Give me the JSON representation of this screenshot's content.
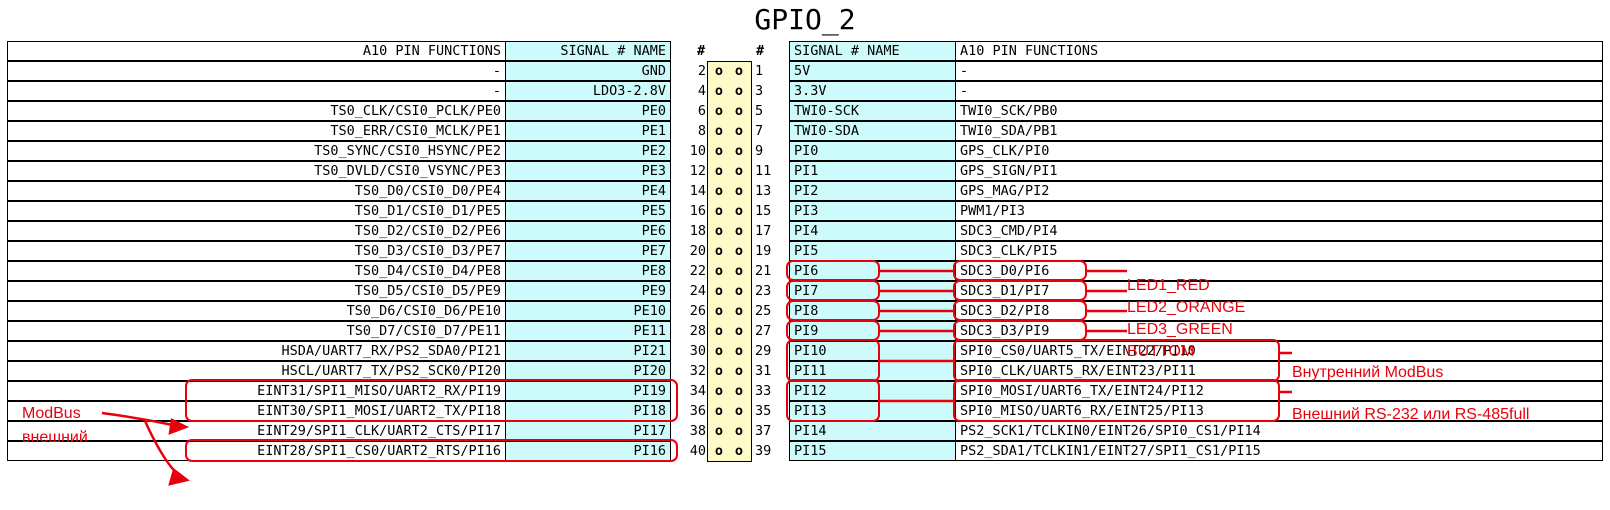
{
  "title": "GPIO_2",
  "header": {
    "left_func": "A10 PIN FUNCTIONS",
    "left_signal": "SIGNAL # NAME",
    "left_hash": "#",
    "right_hash": "#",
    "right_signal": "SIGNAL # NAME",
    "right_func": "A10 PIN FUNCTIONS"
  },
  "pin_marker": "o",
  "rows": [
    {
      "lf": "-",
      "ls": "GND",
      "ln": "2",
      "rn": "1",
      "rs": "5V",
      "rf": "-"
    },
    {
      "lf": "-",
      "ls": "LDO3-2.8V",
      "ln": "4",
      "rn": "3",
      "rs": "3.3V",
      "rf": "-"
    },
    {
      "lf": "TS0_CLK/CSI0_PCLK/PE0",
      "ls": "PE0",
      "ln": "6",
      "rn": "5",
      "rs": "TWI0-SCK",
      "rf": "TWI0_SCK/PB0"
    },
    {
      "lf": "TS0_ERR/CSI0_MCLK/PE1",
      "ls": "PE1",
      "ln": "8",
      "rn": "7",
      "rs": "TWI0-SDA",
      "rf": "TWI0_SDA/PB1"
    },
    {
      "lf": "TS0_SYNC/CSI0_HSYNC/PE2",
      "ls": "PE2",
      "ln": "10",
      "rn": "9",
      "rs": "PI0",
      "rf": "GPS_CLK/PI0"
    },
    {
      "lf": "TS0_DVLD/CSI0_VSYNC/PE3",
      "ls": "PE3",
      "ln": "12",
      "rn": "11",
      "rs": "PI1",
      "rf": "GPS_SIGN/PI1"
    },
    {
      "lf": "TS0_D0/CSI0_D0/PE4",
      "ls": "PE4",
      "ln": "14",
      "rn": "13",
      "rs": "PI2",
      "rf": "GPS_MAG/PI2"
    },
    {
      "lf": "TS0_D1/CSI0_D1/PE5",
      "ls": "PE5",
      "ln": "16",
      "rn": "15",
      "rs": "PI3",
      "rf": "PWM1/PI3"
    },
    {
      "lf": "TS0_D2/CSI0_D2/PE6",
      "ls": "PE6",
      "ln": "18",
      "rn": "17",
      "rs": "PI4",
      "rf": "SDC3_CMD/PI4"
    },
    {
      "lf": "TS0_D3/CSI0_D3/PE7",
      "ls": "PE7",
      "ln": "20",
      "rn": "19",
      "rs": "PI5",
      "rf": "SDC3_CLK/PI5"
    },
    {
      "lf": "TS0_D4/CSI0_D4/PE8",
      "ls": "PE8",
      "ln": "22",
      "rn": "21",
      "rs": "PI6",
      "rf": "SDC3_D0/PI6"
    },
    {
      "lf": "TS0_D5/CSI0_D5/PE9",
      "ls": "PE9",
      "ln": "24",
      "rn": "23",
      "rs": "PI7",
      "rf": "SDC3_D1/PI7"
    },
    {
      "lf": "TS0_D6/CSI0_D6/PE10",
      "ls": "PE10",
      "ln": "26",
      "rn": "25",
      "rs": "PI8",
      "rf": "SDC3_D2/PI8"
    },
    {
      "lf": "TS0_D7/CSI0_D7/PE11",
      "ls": "PE11",
      "ln": "28",
      "rn": "27",
      "rs": "PI9",
      "rf": "SDC3_D3/PI9"
    },
    {
      "lf": "HSDA/UART7_RX/PS2_SDA0/PI21",
      "ls": "PI21",
      "ln": "30",
      "rn": "29",
      "rs": "PI10",
      "rf": "SPI0_CS0/UART5_TX/EINT22/PI10"
    },
    {
      "lf": "HSCL/UART7_TX/PS2_SCK0/PI20",
      "ls": "PI20",
      "ln": "32",
      "rn": "31",
      "rs": "PI11",
      "rf": "SPI0_CLK/UART5_RX/EINT23/PI11"
    },
    {
      "lf": "EINT31/SPI1_MISO/UART2_RX/PI19",
      "ls": "PI19",
      "ln": "34",
      "rn": "33",
      "rs": "PI12",
      "rf": "SPI0_MOSI/UART6_TX/EINT24/PI12"
    },
    {
      "lf": "EINT30/SPI1_MOSI/UART2_TX/PI18",
      "ls": "PI18",
      "ln": "36",
      "rn": "35",
      "rs": "PI13",
      "rf": "SPI0_MISO/UART6_RX/EINT25/PI13"
    },
    {
      "lf": "EINT29/SPI1_CLK/UART2_CTS/PI17",
      "ls": "PI17",
      "ln": "38",
      "rn": "37",
      "rs": "PI14",
      "rf": "PS2_SCK1/TCLKIN0/EINT26/SPI0_CS1/PI14"
    },
    {
      "lf": "EINT28/SPI1_CS0/UART2_RTS/PI16",
      "ls": "PI16",
      "ln": "40",
      "rn": "39",
      "rs": "PI15",
      "rf": "PS2_SDA1/TCLKIN1/EINT27/SPI1_CS1/PI15"
    }
  ],
  "annotations": {
    "led1": "LED1_RED",
    "led2": "LED2_ORANGE",
    "led3": "LED3_GREEN",
    "button": "BUTTOM",
    "modbus_internal": "Внутренний ModBus",
    "rs232": "Внешний RS-232 или RS-485full",
    "modbus_ext_line1": "ModBus",
    "modbus_ext_line2": "внешний"
  },
  "colors": {
    "signal_cell": "#cdfbfb",
    "pin_header": "#fffbc8",
    "annotation": "#e8000b"
  }
}
